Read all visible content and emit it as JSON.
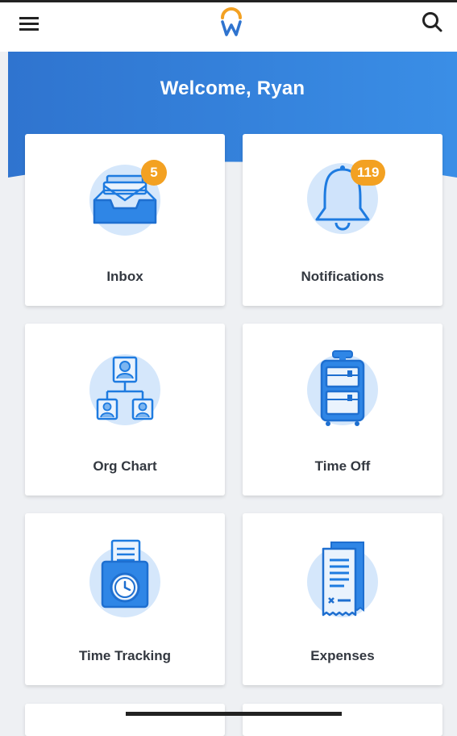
{
  "header": {
    "menu_icon": "hamburger-menu-icon",
    "logo_icon": "workday-logo-icon",
    "search_icon": "search-icon"
  },
  "hero": {
    "greeting": "Welcome, Ryan"
  },
  "tiles": [
    {
      "label": "Inbox",
      "icon": "inbox-tray-icon",
      "badge": "5"
    },
    {
      "label": "Notifications",
      "icon": "bell-icon",
      "badge": "119"
    },
    {
      "label": "Org Chart",
      "icon": "org-chart-icon"
    },
    {
      "label": "Time Off",
      "icon": "suitcase-icon"
    },
    {
      "label": "Time Tracking",
      "icon": "time-clock-icon"
    },
    {
      "label": "Expenses",
      "icon": "receipt-icon"
    }
  ],
  "colors": {
    "brand_blue": "#2f74cf",
    "icon_blue": "#1e7be0",
    "icon_circle": "#d5e7fb",
    "badge_orange": "#f3a122",
    "logo_orange": "#f3a122"
  }
}
